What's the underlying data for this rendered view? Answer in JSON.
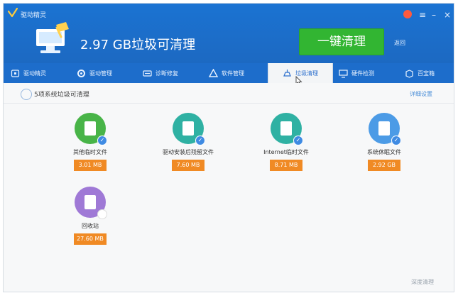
{
  "window": {
    "title": "驱动精灵",
    "controls": {
      "skin": "skin-icon",
      "menu": "≡",
      "minimize": "–",
      "close": "×"
    }
  },
  "hero": {
    "summary": "2.97 GB垃圾可清理",
    "clean_button": "一键清理",
    "clean_button_sub": "返回"
  },
  "tabs": [
    {
      "label": "驱动精灵",
      "icon": "home-icon"
    },
    {
      "label": "驱动管理",
      "icon": "gear-icon"
    },
    {
      "label": "诊断修复",
      "icon": "wrench-icon"
    },
    {
      "label": "软件管理",
      "icon": "app-icon"
    },
    {
      "label": "垃圾清理",
      "icon": "broom-icon",
      "active": true
    },
    {
      "label": "硬件检测",
      "icon": "monitor-icon"
    },
    {
      "label": "百宝箱",
      "icon": "box-icon"
    }
  ],
  "main": {
    "section_title": "5项系统垃圾可清理",
    "detail_link": "详细设置",
    "items": [
      {
        "label": "其他临时文件",
        "size": "3.01 MB",
        "color": "#48b448",
        "icon": "printer-icon"
      },
      {
        "label": "驱动安装后残留文件",
        "size": "7.60 MB",
        "color": "#2fb1a3",
        "icon": "file-icon"
      },
      {
        "label": "Internet临时文件",
        "size": "8.71 MB",
        "color": "#2fb1a3",
        "icon": "browser-icon"
      },
      {
        "label": "系统休眠文件",
        "size": "2.92 GB",
        "color": "#4c9be6",
        "icon": "doc-icon"
      },
      {
        "label": "回收站",
        "size": "27.60 MB",
        "color": "#9f79d6",
        "icon": "trash-icon"
      }
    ],
    "bottom_link": "深度清理"
  }
}
